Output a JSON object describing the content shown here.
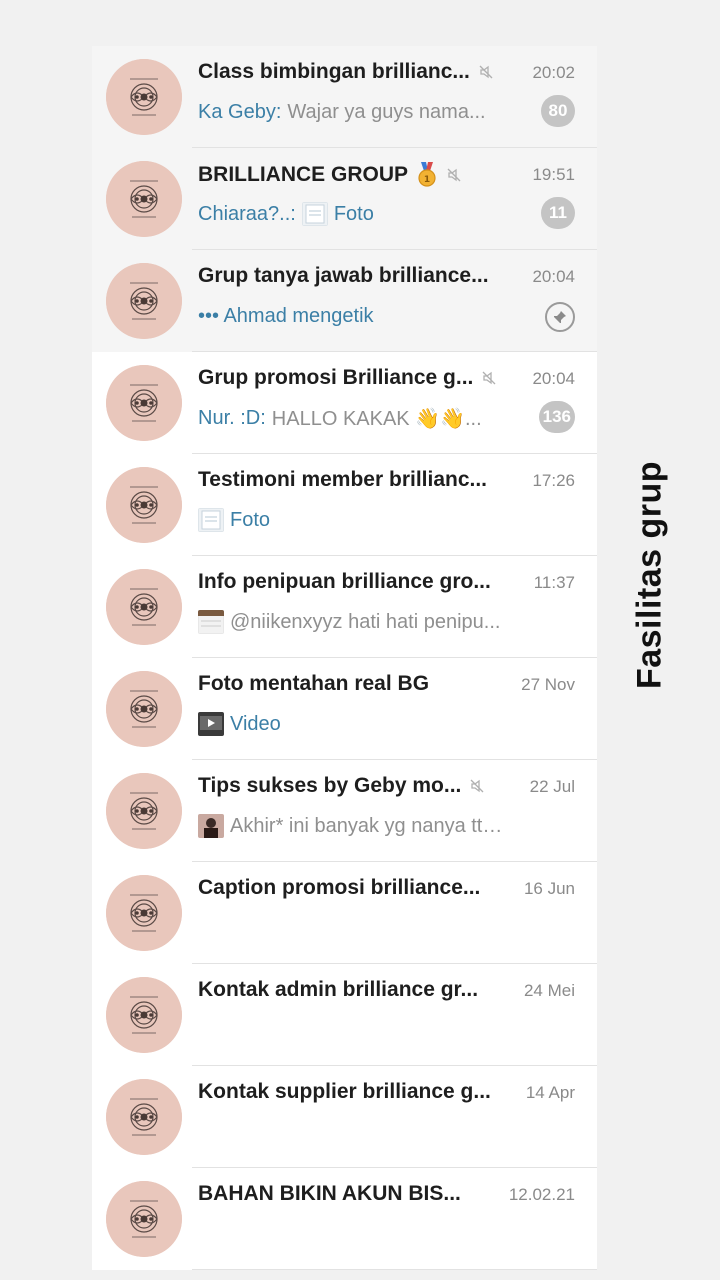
{
  "side_label": "Fasilitas grup",
  "colors": {
    "accent_blue": "#3b7fa6",
    "badge_gray": "#c4c4c4",
    "avatar_pink": "#e9c7bc"
  },
  "chats": [
    {
      "name": "Class bimbingan brillianc...",
      "time": "20:02",
      "sender": "Ka Geby:",
      "text": "Wajar ya guys nama...",
      "badge": "80",
      "muted": true,
      "pinned": true
    },
    {
      "name": "BRILLIANCE GROUP",
      "time": "19:51",
      "sender": "Chiaraa?..:",
      "media": "Foto",
      "badge": "11",
      "muted": true,
      "medal": true,
      "pinned": true,
      "thumb": "photo-thumb"
    },
    {
      "name": "Grup tanya jawab brilliance...",
      "time": "20:04",
      "typing": "••• Ahmad mengetik",
      "pinned": true,
      "pin_icon": "pin-icon"
    },
    {
      "name": "Grup promosi Brilliance g...",
      "time": "20:04",
      "sender": "Nur. :D:",
      "text": "HALLO KAKAK 👋👋...",
      "badge": "136",
      "muted": true
    },
    {
      "name": "Testimoni member brillianc...",
      "time": "17:26",
      "media": "Foto",
      "thumb": "photo-thumb"
    },
    {
      "name": "Info penipuan brilliance gro...",
      "time": "11:37",
      "text": "@niikenxyyz hati hati penipu...",
      "thumb": "screenshot-thumb"
    },
    {
      "name": "Foto mentahan real BG",
      "time": "27 Nov",
      "media": "Video",
      "thumb": "video-thumb"
    },
    {
      "name": "Tips sukses by Geby mo...",
      "time": "22 Jul",
      "text": "Akhir* ini banyak yg nanya ttg...",
      "muted": true,
      "thumb": "person-thumb"
    },
    {
      "name": "Caption promosi brilliance...",
      "time": "16 Jun"
    },
    {
      "name": "Kontak admin brilliance gr...",
      "time": "24 Mei"
    },
    {
      "name": "Kontak supplier brilliance g...",
      "time": "14 Apr"
    },
    {
      "name": "BAHAN BIKIN AKUN BIS...",
      "time": "12.02.21"
    }
  ]
}
